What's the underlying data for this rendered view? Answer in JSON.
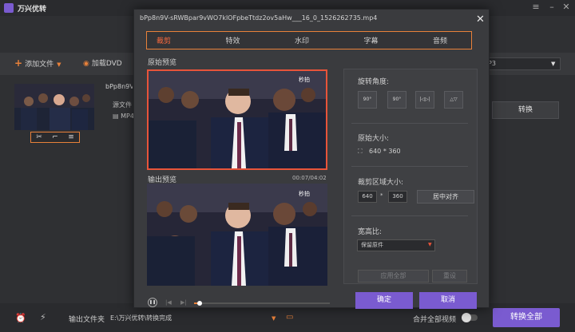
{
  "app": {
    "title": "万兴优转"
  },
  "toolbar": {
    "add_file": "添加文件",
    "load_dvd": "加载DVD",
    "output_format": "P3"
  },
  "file": {
    "name": "bPp8n9V-sRWBpar9vWO7klOFpbeTtdz2ov5aHw___16_0_1526262735.mp4",
    "source_label": "源文件",
    "format": "MP4",
    "convert_label": "转换"
  },
  "bottom": {
    "output_folder_label": "输出文件夹",
    "output_path": "E:\\万兴优转\\转换完成",
    "merge_label": "合并全部视频",
    "convert_all": "转换全部"
  },
  "modal": {
    "title": "bPp8n9V-sRWBpar9vWO7klOFpbeTtdz2ov5aHw___16_0_1526262735.mp4",
    "tabs": [
      "裁剪",
      "特效",
      "水印",
      "字幕",
      "音频"
    ],
    "active_tab": "裁剪",
    "original_preview_label": "原始预览",
    "output_preview_label": "输出预览",
    "time_code": "00:07/04:02",
    "watermark": "秒拍",
    "rotation_label": "旋转角度:",
    "rotation_buttons": [
      "90°",
      "90°",
      "|◁▷|",
      "△▽"
    ],
    "original_size_label": "原始大小:",
    "original_size_value": "640 * 360",
    "crop_area_label": "裁剪区域大小:",
    "crop_width": "640",
    "crop_height": "360",
    "crop_separator": "*",
    "center_button": "居中对齐",
    "aspect_ratio_label": "宽高比:",
    "aspect_ratio_value": "保留原件",
    "apply_all": "应用全部",
    "reset": "重设",
    "ok": "确定",
    "cancel": "取消"
  },
  "colors": {
    "accent": "#e8813a",
    "primary": "#7a5bd0",
    "active_tab": "#ff6b3d",
    "crop_frame": "#e8543a"
  }
}
